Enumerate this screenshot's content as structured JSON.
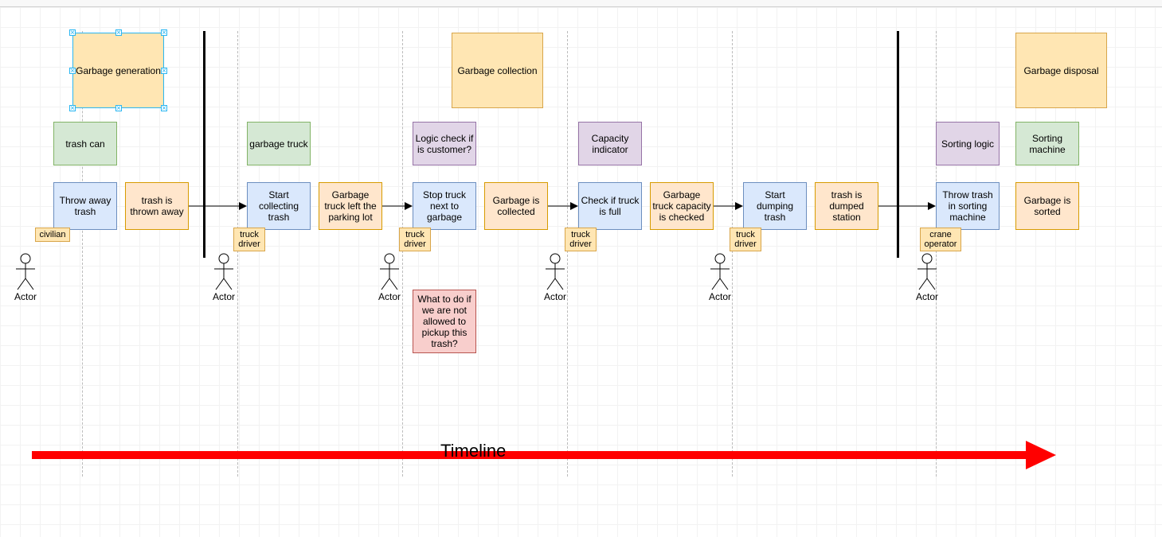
{
  "phases": {
    "generation": "Garbage generation",
    "collection": "Garbage collection",
    "disposal": "Garbage disposal"
  },
  "components": {
    "trash_can": "trash can",
    "garbage_truck": "garbage truck",
    "logic_check": "Logic check if is customer?",
    "capacity": "Capacity indicator",
    "sort_logic": "Sorting logic",
    "sort_machine": "Sorting machine"
  },
  "actions": {
    "a1": "Throw away trash",
    "a2": "Start collecting trash",
    "a3": "Stop truck next to garbage",
    "a4": "Check if truck is full",
    "a5": "Start dumping trash",
    "a6": "Throw trash in sorting machine"
  },
  "events": {
    "e1": "trash is thrown away",
    "e2": "Garbage truck left the parking lot",
    "e3": "Garbage is collected",
    "e4": "Garbage truck capacity is checked",
    "e5": "trash is dumped station",
    "e6": "Garbage is sorted"
  },
  "roles": {
    "civilian": "civilian",
    "truck_driver": "truck driver",
    "crane_op": "crane operator"
  },
  "actor_label": "Actor",
  "note": "What to do if we are not allowed to pickup this trash?",
  "timeline_label": "Timeline"
}
